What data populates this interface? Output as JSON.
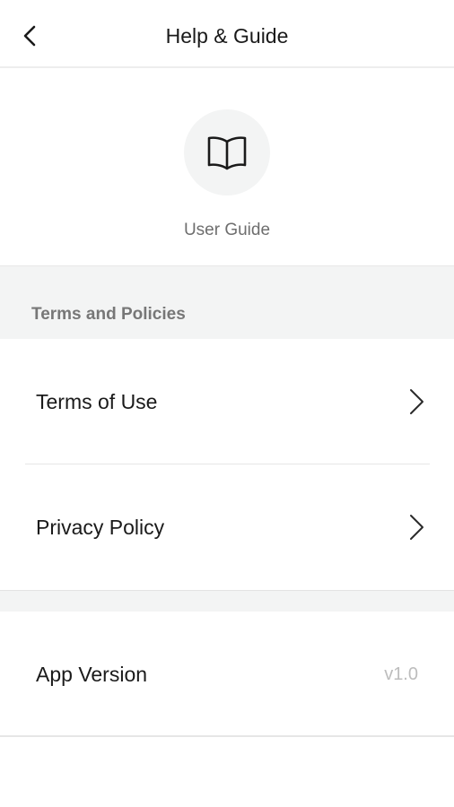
{
  "header": {
    "title": "Help & Guide",
    "back_icon": "chevron-left-icon"
  },
  "guide": {
    "icon": "open-book-icon",
    "label": "User Guide"
  },
  "terms_section": {
    "title": "Terms and Policies",
    "items": [
      {
        "label": "Terms of Use",
        "icon": "chevron-right-icon"
      },
      {
        "label": "Privacy Policy",
        "icon": "chevron-right-icon"
      }
    ]
  },
  "app_version": {
    "label": "App Version",
    "value": "v1.0"
  }
}
